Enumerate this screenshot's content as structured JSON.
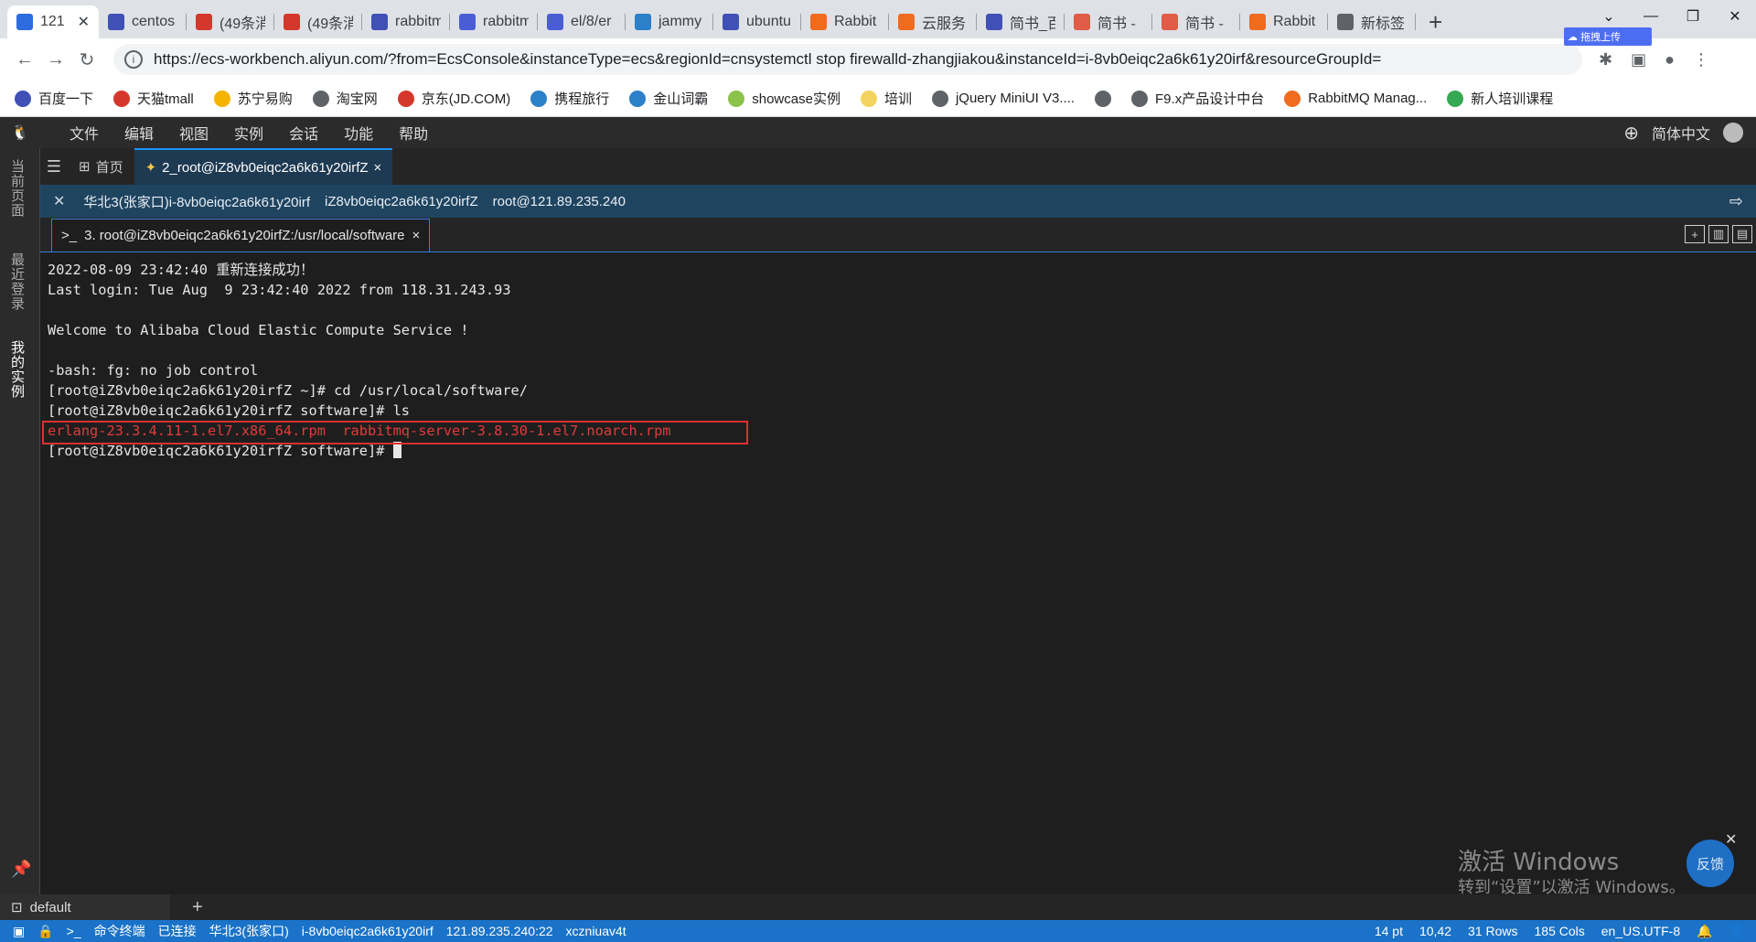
{
  "browser": {
    "tabs": [
      {
        "label": "121",
        "color": "#2d6cdf",
        "active": true
      },
      {
        "label": "centos",
        "color": "#3f51b5"
      },
      {
        "label": "(49条消",
        "color": "#d4382c"
      },
      {
        "label": "(49条消",
        "color": "#d4382c"
      },
      {
        "label": "rabbitm",
        "color": "#3f51b5"
      },
      {
        "label": "rabbitm",
        "color": "#4a5dd6"
      },
      {
        "label": "el/8/er",
        "color": "#4a5dd6"
      },
      {
        "label": "jammy",
        "color": "#2c7fc9"
      },
      {
        "label": "ubuntu",
        "color": "#3f51b5"
      },
      {
        "label": "Rabbit",
        "color": "#f06b1e"
      },
      {
        "label": "云服务",
        "color": "#f06b1e"
      },
      {
        "label": "简书_百",
        "color": "#3f51b5"
      },
      {
        "label": "简书 -",
        "color": "#e05c46"
      },
      {
        "label": "简书 -",
        "color": "#e05c46"
      },
      {
        "label": "Rabbit",
        "color": "#f06b1e"
      },
      {
        "label": "新标签",
        "color": "#5f6368"
      }
    ],
    "url": "https://ecs-workbench.aliyun.com/?from=EcsConsole&instanceType=ecs&regionId=cnsystemctl stop firewalld-zhangjiakou&instanceId=i-8vb0eiqc2a6k61y20irf&resourceGroupId=",
    "baidu_upload": "拖拽上传",
    "bookmarks": [
      {
        "label": "百度一下",
        "color": "#3f51b5"
      },
      {
        "label": "天猫tmall",
        "color": "#d4382c"
      },
      {
        "label": "苏宁易购",
        "color": "#f4b400"
      },
      {
        "label": "淘宝网",
        "color": "#5f6368"
      },
      {
        "label": "京东(JD.COM)",
        "color": "#d4382c"
      },
      {
        "label": "携程旅行",
        "color": "#2c7fc9"
      },
      {
        "label": "金山词霸",
        "color": "#2c7fc9"
      },
      {
        "label": "showcase实例",
        "color": "#8bc34a"
      },
      {
        "label": "培训",
        "color": "#f4d35e"
      },
      {
        "label": "jQuery MiniUI V3....",
        "color": "#5f6368"
      },
      {
        "label": "",
        "color": "#5f6368"
      },
      {
        "label": "F9.x产品设计中台",
        "color": "#5f6368"
      },
      {
        "label": "RabbitMQ Manag...",
        "color": "#f06b1e"
      },
      {
        "label": "新人培训课程",
        "color": "#34a853"
      }
    ]
  },
  "app": {
    "menu": [
      "文件",
      "编辑",
      "视图",
      "实例",
      "会话",
      "功能",
      "帮助"
    ],
    "language": "简体中文",
    "rail": [
      "当前页面",
      "最近登录",
      "我的实例"
    ],
    "ws_tabs": {
      "home": "首页",
      "session": "2_root@iZ8vb0eiqc2a6k61y20irfZ"
    },
    "instance_bar": [
      "华北3(张家口)i-8vb0eiqc2a6k61y20irf",
      "iZ8vb0eiqc2a6k61y20irfZ",
      "root@121.89.235.240"
    ],
    "terminal_tab": "3. root@iZ8vb0eiqc2a6k61y20irfZ:/usr/local/software",
    "terminal_lines": [
      "2022-08-09 23:42:40 重新连接成功！",
      "Last login: Tue Aug  9 23:42:40 2022 from 118.31.243.93",
      "",
      "Welcome to Alibaba Cloud Elastic Compute Service !",
      "",
      "-bash: fg: no job control",
      "[root@iZ8vb0eiqc2a6k61y20irfZ ~]# cd /usr/local/software/",
      "[root@iZ8vb0eiqc2a6k61y20irfZ software]# ls"
    ],
    "ls_output": "erlang-23.3.4.11-1.el7.x86_64.rpm  rabbitmq-server-3.8.30-1.el7.noarch.rpm",
    "prompt": "[root@iZ8vb0eiqc2a6k61y20irfZ software]# ",
    "watermark_title": "激活 Windows",
    "watermark_sub": "转到“设置”以激活 Windows。",
    "feedback": "反馈",
    "session_name": "default",
    "status": {
      "left": [
        "命令终端",
        "已连接",
        "华北3(张家口)",
        "i-8vb0eiqc2a6k61y20irf",
        "121.89.235.240:22",
        "xczniuav4t"
      ],
      "right": [
        "14 pt",
        "10,42",
        "31 Rows",
        "185 Cols",
        "en_US.UTF-8"
      ]
    }
  }
}
